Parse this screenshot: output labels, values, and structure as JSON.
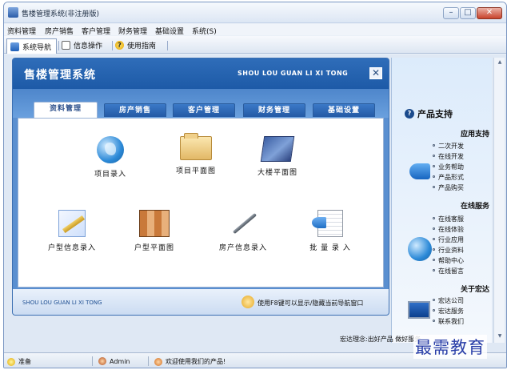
{
  "window": {
    "title": "售楼管理系统(非注册版)",
    "controls": {
      "minimize": "–",
      "maximize": "□",
      "close": "✕"
    }
  },
  "menubar": [
    "资料管理",
    "房产销售",
    "客户管理",
    "财务管理",
    "基础设置",
    "系统(S)"
  ],
  "toolbar": {
    "nav_label": "系统导航",
    "info_label": "信息操作",
    "help_label": "使用指南",
    "help_glyph": "?"
  },
  "nav_panel": {
    "title": "售楼管理系统",
    "pinyin": "SHOU LOU GUAN LI XI TONG",
    "close_glyph": "✕",
    "tabs": [
      "资料管理",
      "房产销售",
      "客户管理",
      "财务管理",
      "基础设置"
    ],
    "active_tab": "资料管理",
    "items": [
      {
        "label": "项目录入",
        "icon": "globe-icon"
      },
      {
        "label": "项目平面图",
        "icon": "folder-icon"
      },
      {
        "label": "大楼平面图",
        "icon": "blueprint-icon"
      },
      {
        "label": "户型信息录入",
        "icon": "pencil-icon"
      },
      {
        "label": "户型平面图",
        "icon": "floorplan-icon"
      },
      {
        "label": "房产信息录入",
        "icon": "pen-icon"
      },
      {
        "label": "批 量 录 入",
        "icon": "batch-icon"
      }
    ],
    "footer_pinyin": "SHOU LOU GUAN LI XI TONG",
    "footer_tip": "使用F8键可以显示/隐藏当前导航窗口"
  },
  "side_panel": {
    "title": "产品支持",
    "title_glyph": "?",
    "groups": [
      {
        "title": "应用支持",
        "links": [
          "二次开发",
          "在线开发",
          "业务帮助",
          "产品形式",
          "产品购买"
        ]
      },
      {
        "title": "在线服务",
        "links": [
          "在线客服",
          "在线体验",
          "行业应用",
          "行业资料",
          "帮助中心",
          "在线留言"
        ]
      },
      {
        "title": "关于宏达",
        "links": [
          "宏达公司",
          "宏达服务",
          "联系我们"
        ]
      }
    ],
    "slogan": "宏达理念:出好产品 做好服务",
    "scroll_up": "▲",
    "scroll_down": "▼"
  },
  "statusbar": {
    "ready": "准备",
    "user": "Admin",
    "welcome": "欢迎使用我们的产品!"
  },
  "watermark": "最需教育",
  "colors": {
    "header_blue": "#1d5aa7",
    "tab_active_text": "#2a4e8a",
    "panel_bg": "#dfe8f4",
    "watermark": "#2a3fa8"
  }
}
